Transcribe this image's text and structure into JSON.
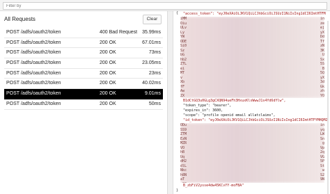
{
  "filter": {
    "placeholder": "Filter by"
  },
  "list": {
    "title": "All Requests",
    "clear_label": "Clear",
    "rows": [
      {
        "request": "POST /adfs/oauth2/token",
        "status": "400 Bad Request",
        "time": "35.99ms"
      },
      {
        "request": "POST /adfs/oauth2/token",
        "status": "200 OK",
        "time": "67.01ms"
      },
      {
        "request": "POST /adfs/oauth2/token",
        "status": "200 OK",
        "time": "73ms"
      },
      {
        "request": "POST /adfs/oauth2/token",
        "status": "200 OK",
        "time": "23.05ms"
      },
      {
        "request": "POST /adfs/oauth2/token",
        "status": "200 OK",
        "time": "23ms"
      },
      {
        "request": "POST /adfs/oauth2/token",
        "status": "200 OK",
        "time": "40.02ms"
      },
      {
        "request": "POST /adfs/oauth2/token",
        "status": "200 OK",
        "time": "9.01ms"
      },
      {
        "request": "POST /adfs/oauth2/token",
        "status": "200 OK",
        "time": "50ms"
      }
    ],
    "selected_index": 6
  },
  "response": {
    "open_brace": "{",
    "access_token_line": "\"access_token\": \"eyJ0eXAiOiJKV1QiLCJhbGciOiJSUzI1NiIsIng1dCI6ImtHTFM",
    "access_token_end": "B1dCtGQ3u0GLg3gCXQN94ueFh3HxuxKlsWwwJ1s4Yd6dYlw\",",
    "token_type_line": "\"token_type\": \"bearer\",",
    "expires_in_line": "\"expires_in\": 3600,",
    "scope_line": "\"scope\": \"profile openid email allatclaims\",",
    "id_token_line": "\"id_token\": \"eyJ0eXAiOiJKV1QiLCJhbGciOiJSUzI1NiIsIng1dCI6ImtHTFYMHQMZ",
    "id_token_end": "B_zbFiV2ysse4dw45KCvYY-moFBA\"",
    "close_brace": "}",
    "blur1_left": [
      "iMM",
      "Oiu",
      "ULv",
      "Ly",
      "YW",
      "ODE",
      "Si0",
      "Sz",
      "bG",
      "hb2",
      "ZTL",
      "ei",
      "MT",
      "v",
      "Xb",
      "fF",
      "Aw",
      "ZX"
    ],
    "blur1_right": [
      "in",
      "ze",
      "ej",
      "yX",
      "Dd",
      "Tf",
      "zN",
      "3K",
      "U",
      "Sx",
      "5S",
      "B",
      "5Q",
      "yX",
      "3d",
      "Gk",
      "zh",
      "YO"
    ],
    "blur2_left": [
      "ODu",
      "SS9",
      "ZTM",
      "EzN",
      "MZR",
      "VO",
      "hB",
      "Uq",
      "dH2",
      "dlL",
      "Nkc",
      "h8N",
      "aT",
      "z9Q",
      "oyj",
      "TWV",
      "QOO",
      "4x",
      "a99"
    ],
    "blur2_right": [
      "in",
      "yq",
      "LW",
      "Sn",
      "g",
      "Vp",
      "2q",
      "VG",
      "5P",
      "St",
      "w",
      "S2",
      "9N",
      "g",
      "fw",
      "QY",
      "5q",
      "yq",
      "V"
    ]
  }
}
